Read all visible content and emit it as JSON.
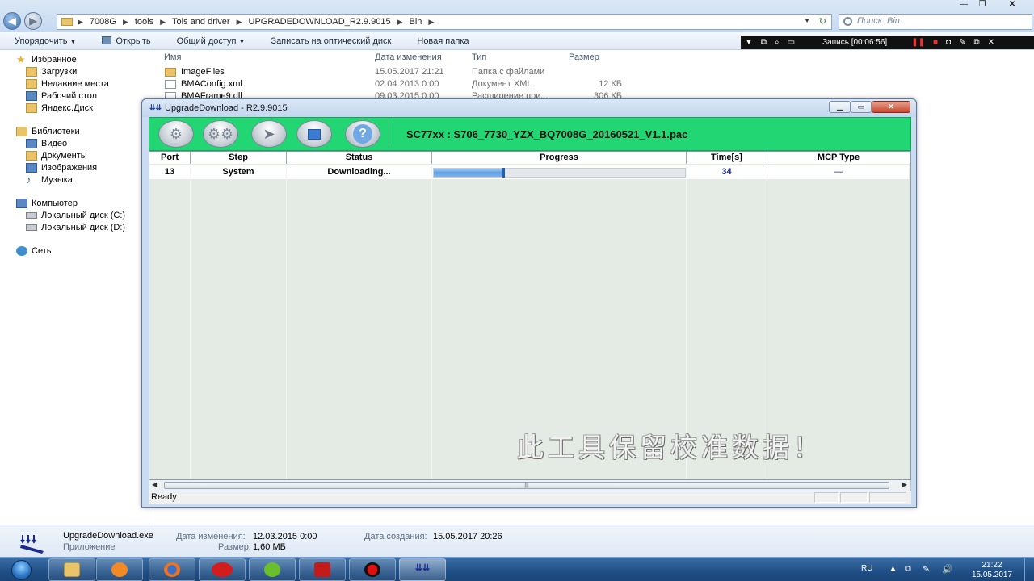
{
  "explorer": {
    "breadcrumbs": [
      "7008G",
      "tools",
      "Tols and driver",
      "UPGRADEDOWNLOAD_R2.9.9015",
      "Bin"
    ],
    "search_placeholder": "Поиск: Bin",
    "commands": {
      "organize": "Упорядочить",
      "open": "Открыть",
      "share": "Общий доступ",
      "burn": "Записать на оптический диск",
      "new_folder": "Новая папка"
    },
    "recorder": {
      "label": "Запись [00:06:56]"
    },
    "nav": {
      "favorites": "Избранное",
      "downloads": "Загрузки",
      "recent": "Недавние места",
      "desktop": "Рабочий стол",
      "yandex": "Яндекс.Диск",
      "libraries": "Библиотеки",
      "video": "Видео",
      "documents": "Документы",
      "images": "Изображения",
      "music": "Музыка",
      "computer": "Компьютер",
      "disk_c": "Локальный диск (C:)",
      "disk_d": "Локальный диск (D:)",
      "network": "Сеть"
    },
    "columns": {
      "name": "Имя",
      "date": "Дата изменения",
      "type": "Тип",
      "size": "Размер"
    },
    "files": [
      {
        "name": "ImageFiles",
        "date": "15.05.2017 21:21",
        "type": "Папка с файлами",
        "size": "",
        "icon": "folder-icon"
      },
      {
        "name": "BMAConfig.xml",
        "date": "02.04.2013 0:00",
        "type": "Документ XML",
        "size": "12 КБ",
        "icon": "xml-file-icon"
      },
      {
        "name": "BMAFrame9.dll",
        "date": "09.03.2015 0:00",
        "type": "Расширение при...",
        "size": "306 КБ",
        "icon": "dll-file-icon"
      }
    ],
    "details": {
      "filename": "UpgradeDownload.exe",
      "filetype": "Приложение",
      "modified_label": "Дата изменения:",
      "modified_value": "12.03.2015 0:00",
      "size_label": "Размер:",
      "size_value": "1,60 МБ",
      "created_label": "Дата создания:",
      "created_value": "15.05.2017 20:26"
    }
  },
  "app": {
    "title": "UpgradeDownload - R2.9.9015",
    "pac_file": "SC77xx : S706_7730_YZX_BQ7008G_20160521_V1.1.pac",
    "columns": [
      "Port",
      "Step",
      "Status",
      "Progress",
      "Time[s]",
      "MCP Type"
    ],
    "rows": [
      {
        "port": "13",
        "step": "System",
        "status": "Downloading...",
        "progress": 0.28,
        "time": "34",
        "mcp": "—"
      }
    ],
    "watermark": "此工具保留校准数据！",
    "status": "Ready",
    "toolbar": [
      "settings-icon",
      "config-icon",
      "start-icon",
      "stop-icon",
      "help-icon"
    ],
    "accent_color": "#22d673",
    "progress_color": "#5f9fe4"
  },
  "taskbar": {
    "lang": "RU",
    "time": "21:22",
    "date": "15.05.2017",
    "apps": [
      "explorer-icon",
      "media-player-icon",
      "firefox-icon",
      "opera-icon",
      "utorrent-icon",
      "acrobat-icon",
      "recorder-icon",
      "upgradedownload-icon"
    ]
  }
}
